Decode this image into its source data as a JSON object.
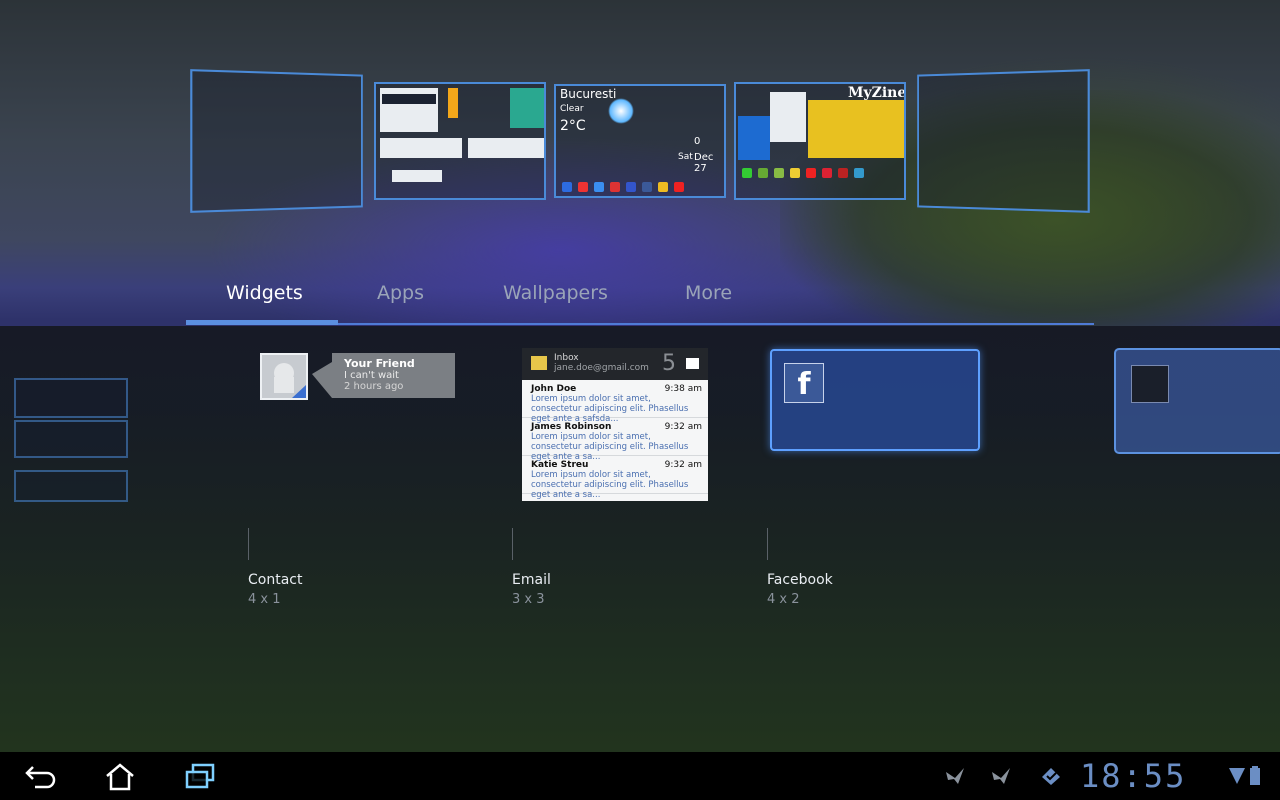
{
  "home_previews": {
    "weather": {
      "city": "Bucuresti",
      "condition": "Clear",
      "temperature": "2°C",
      "unread": "0",
      "date_day": "Sat",
      "date": "Dec 27"
    },
    "magazine": {
      "title": "MyZine"
    }
  },
  "tabs": [
    {
      "label": "Widgets",
      "active": true
    },
    {
      "label": "Apps",
      "active": false
    },
    {
      "label": "Wallpapers",
      "active": false
    },
    {
      "label": "More",
      "active": false
    }
  ],
  "widgets": {
    "contact": {
      "label": "Contact",
      "size": "4 x 1",
      "name": "Your Friend",
      "message": "I can't wait",
      "time": "2 hours ago"
    },
    "email": {
      "label": "Email",
      "size": "3 x 3",
      "folder": "Inbox",
      "account": "jane.doe@gmail.com",
      "count": "5",
      "messages": [
        {
          "from": "John Doe",
          "time": "9:38 am",
          "body": "Lorem ipsum dolor sit amet, consectetur adipiscing elit. Phasellus eget ante a safsda..."
        },
        {
          "from": "James Robinson",
          "time": "9:32 am",
          "body": "Lorem ipsum dolor sit amet, consectetur adipiscing elit. Phasellus eget ante a sa..."
        },
        {
          "from": "Katie Streu",
          "time": "9:32 am",
          "body": "Lorem ipsum dolor sit amet, consectetur adipiscing elit. Phasellus eget ante a sa..."
        }
      ]
    },
    "facebook": {
      "label": "Facebook",
      "size": "4 x 2",
      "logo": "f"
    }
  },
  "system_bar": {
    "clock": "18:55",
    "icons": [
      "back-icon",
      "home-icon",
      "recent-apps-icon",
      "notification-icon",
      "notification-icon",
      "sync-icon",
      "signal-icon",
      "battery-icon"
    ]
  }
}
